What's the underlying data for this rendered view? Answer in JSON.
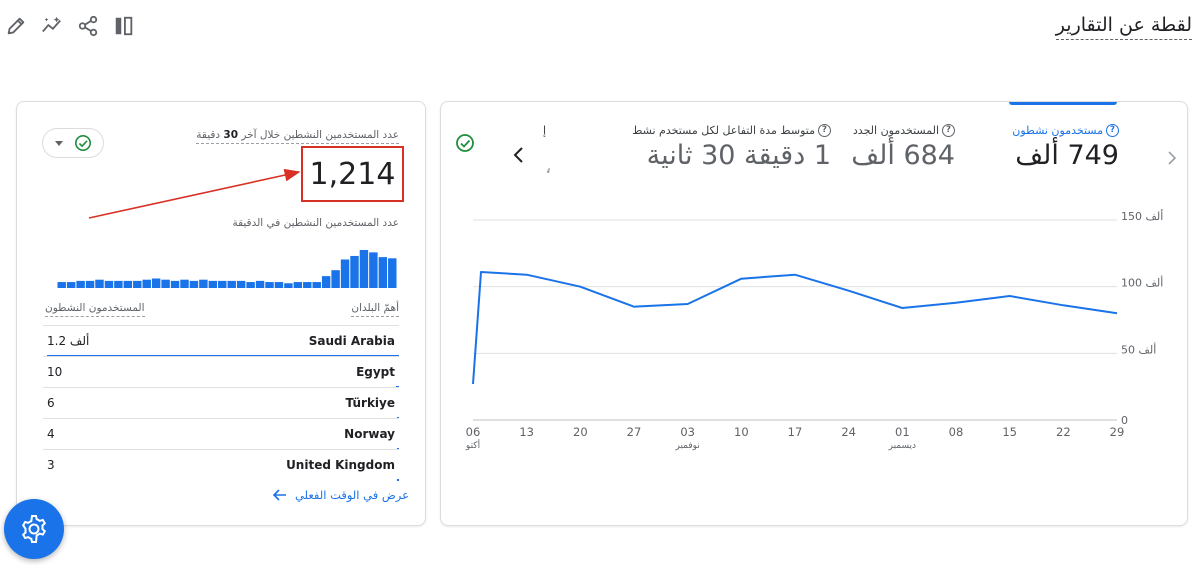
{
  "page": {
    "title": "لقطة عن التقارير"
  },
  "toolbar": {
    "icons": [
      "edit-icon",
      "insights-icon",
      "share-icon",
      "compare-icon"
    ]
  },
  "realtime_card": {
    "label_prefix": "عدد المستخدمين النشطين خلال آخر",
    "label_minutes": "30",
    "label_suffix": "دقيقة",
    "value": "1,214",
    "per_minute_label": "عدد المستخدمين النشطين في الدقيقة",
    "per_minute_bars": [
      5,
      5,
      6,
      6,
      7,
      6,
      6,
      6,
      6,
      7,
      8,
      7,
      6,
      7,
      6,
      7,
      6,
      6,
      6,
      6,
      5,
      6,
      5,
      5,
      4,
      5,
      5,
      5,
      10,
      15,
      24,
      27,
      32,
      30,
      26,
      25
    ],
    "table_header_country": "أهمّ البلدان",
    "table_header_users": "المستخدمون النشطون",
    "rows": [
      {
        "country": "Saudi Arabia",
        "value": "1.2 ألف",
        "share": 0.99
      },
      {
        "country": "Egypt",
        "value": "10",
        "share": 0.008
      },
      {
        "country": "Türkiye",
        "value": "6",
        "share": 0.005
      },
      {
        "country": "Norway",
        "value": "4",
        "share": 0.004
      },
      {
        "country": "United Kingdom",
        "value": "3",
        "share": 0.003
      }
    ],
    "link_label": "عرض في الوقت الفعلي"
  },
  "metrics_card": {
    "metrics": [
      {
        "label": "مستخدمون نشطون",
        "value": "749 ألف",
        "active": true
      },
      {
        "label": "المستخدمون الجدد",
        "value": "684 ألف",
        "active": false
      },
      {
        "label": "متوسط مدة التفاعل لكل مستخدم نشط",
        "value": "1 دقيقة 30 ثانية",
        "active": false
      }
    ],
    "cut_label": "إ",
    "cut_value": "،"
  },
  "chart_data": {
    "type": "line",
    "x": [
      "06",
      "07",
      "08",
      "09",
      "10",
      "11",
      "12",
      "13",
      "14",
      "15",
      "16",
      "17",
      "18",
      "19",
      "20",
      "21",
      "22",
      "23",
      "24",
      "25",
      "26",
      "27",
      "28",
      "29"
    ],
    "x_tick_labels": [
      "06",
      "13",
      "20",
      "27",
      "03",
      "10",
      "17",
      "24",
      "01",
      "08",
      "15",
      "22",
      "29"
    ],
    "x_month_labels": [
      "أكتو",
      "نوفمبر",
      "ديسمبر"
    ],
    "series": [
      {
        "values": [
          27,
          111,
          109,
          100,
          85,
          87,
          106,
          109,
          97,
          84,
          88,
          93,
          86,
          80
        ]
      }
    ],
    "series_points_x": [
      "06",
      "07",
      "13",
      "20",
      "27",
      "03",
      "10",
      "17",
      "24",
      "01",
      "08",
      "15",
      "22",
      "29"
    ],
    "y_tick_labels": [
      "150 ألف",
      "100 ألف",
      "50 ألف",
      "0"
    ],
    "y_ticks": [
      150,
      100,
      50,
      0
    ],
    "ylim": [
      0,
      150
    ],
    "color": "#1a73e8",
    "grid": true
  },
  "colors": {
    "accent": "#1a73e8",
    "highlight": "#d93025",
    "success": "#1e8e3e"
  }
}
